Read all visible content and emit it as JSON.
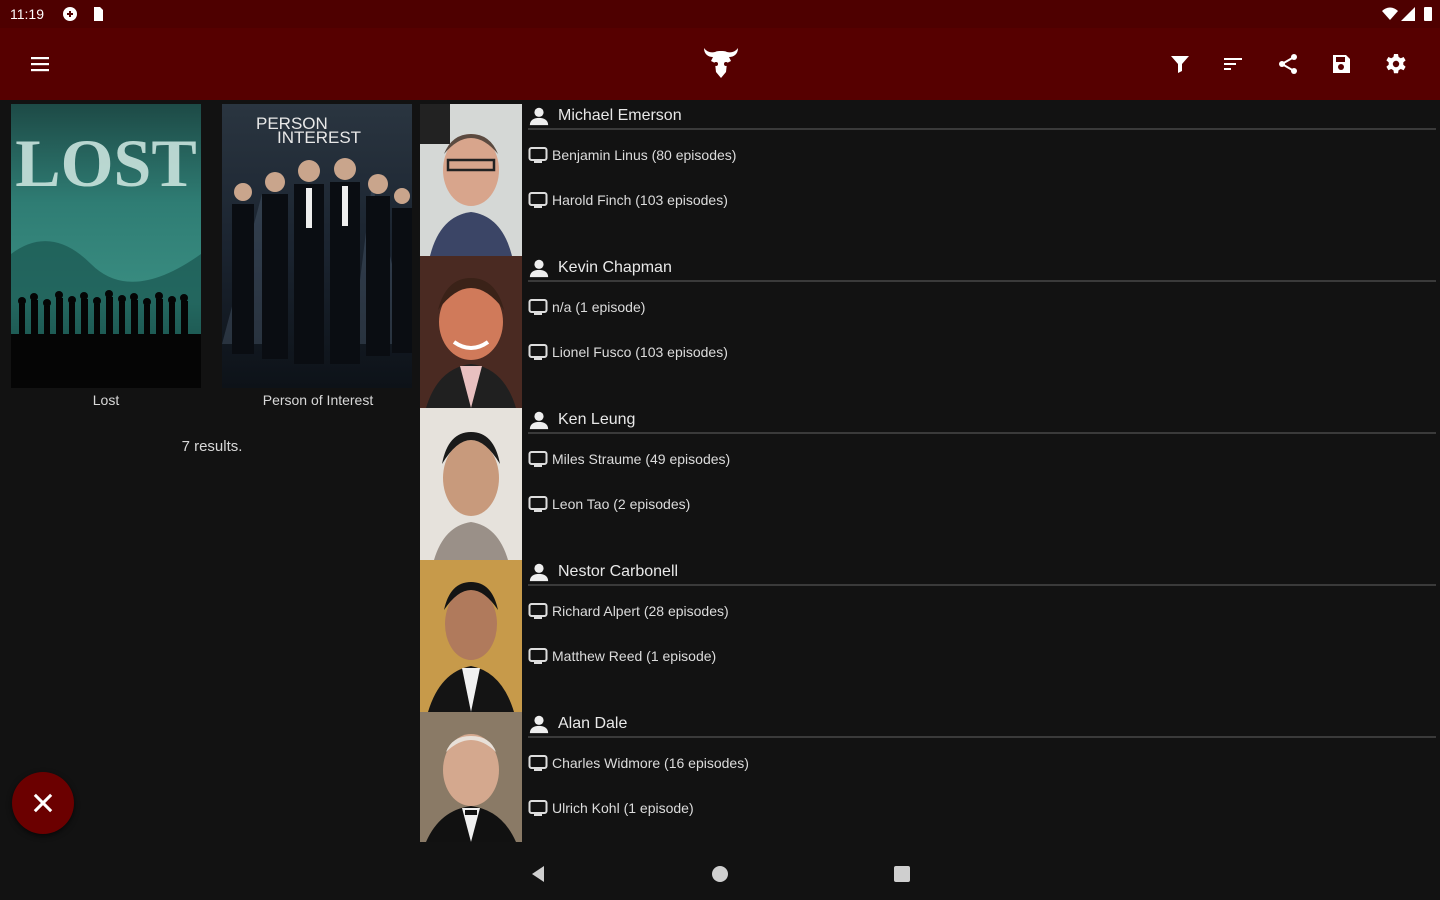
{
  "status_bar": {
    "time": "11:19"
  },
  "app_bar": {
    "icons": [
      "menu-icon",
      "bull-logo-icon",
      "filter-icon",
      "sort-icon",
      "share-icon",
      "save-icon",
      "settings-icon"
    ]
  },
  "shows": [
    {
      "title": "Lost"
    },
    {
      "title": "Person of Interest"
    }
  ],
  "results_text": "7 results.",
  "actors": [
    {
      "name": "Michael Emerson",
      "roles": [
        "Benjamin Linus (80 episodes)",
        "Harold Finch (103 episodes)"
      ]
    },
    {
      "name": "Kevin Chapman",
      "roles": [
        "n/a (1 episode)",
        "Lionel Fusco (103 episodes)"
      ]
    },
    {
      "name": "Ken Leung",
      "roles": [
        "Miles Straume (49 episodes)",
        "Leon Tao (2 episodes)"
      ]
    },
    {
      "name": "Nestor Carbonell",
      "roles": [
        "Richard Alpert (28 episodes)",
        "Matthew Reed (1 episode)"
      ]
    },
    {
      "name": "Alan Dale",
      "roles": [
        "Charles Widmore (16 episodes)",
        "Ulrich Kohl (1 episode)"
      ]
    }
  ],
  "colors": {
    "app_bar": "#560000",
    "status_bar": "#4e0000",
    "background": "#121212",
    "fab": "#6b0000"
  }
}
